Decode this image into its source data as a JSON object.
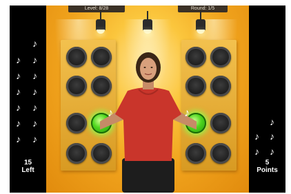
{
  "hud": {
    "level": "Level: 8/28",
    "round": "Round: 1/5"
  },
  "left_counter": {
    "value": "15",
    "label": "Left",
    "notes_shown": 13
  },
  "right_counter": {
    "value": "5",
    "label": "Points",
    "notes_shown": 5
  },
  "board": {
    "left_panel_buttons": [
      "off",
      "off",
      "off",
      "off",
      "lit",
      "off",
      "off",
      "off"
    ],
    "right_panel_buttons": [
      "off",
      "off",
      "off",
      "off",
      "lit",
      "off",
      "off",
      "off"
    ]
  },
  "icons": {
    "note": "music-note-icon",
    "spotlight": "spotlight-icon"
  },
  "colors": {
    "backdrop": "#f0a21c",
    "lit_button": "#4ed61e",
    "unlit_button": "#1e1e1e",
    "shirt": "#c9352b"
  }
}
